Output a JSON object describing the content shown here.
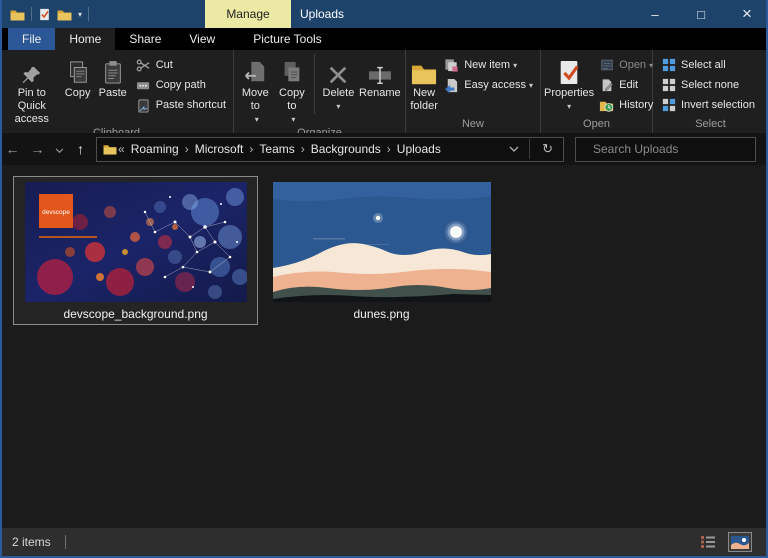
{
  "colors": {
    "titlebar": "#1d436b",
    "window_border": "#2a5a9b",
    "manage_tab_bg": "#ece9a4",
    "file_tab_bg": "#2b5797",
    "ribbon_bg": "#1f1f1f",
    "content_bg": "#1b1b1b",
    "statusbar_bg": "#2e2e2e",
    "select_icon_blue": "#4f9bdc",
    "folder_yellow": "#e9c35c",
    "properties_check_red": "#d14a21"
  },
  "icons": {
    "caret": "▾",
    "back": "←",
    "forward": "→",
    "up": "↑",
    "refresh": "↻",
    "chevrons_left": "«",
    "crumb_sep": "›",
    "minimize": "–",
    "maximize": "□",
    "close": "×"
  },
  "titlebar": {
    "contextual_tab": "Manage",
    "title": "Uploads"
  },
  "tabs": {
    "file": "File",
    "home": "Home",
    "share": "Share",
    "view": "View",
    "picture_tools": "Picture Tools"
  },
  "ribbon": {
    "clipboard": {
      "label": "Clipboard",
      "pin": "Pin to Quick access",
      "copy": "Copy",
      "paste": "Paste",
      "cut": "Cut",
      "copy_path": "Copy path",
      "paste_shortcut": "Paste shortcut"
    },
    "organize": {
      "label": "Organize",
      "move_to": "Move to",
      "copy_to": "Copy to",
      "del": "Delete",
      "rename": "Rename"
    },
    "new_group": {
      "label": "New",
      "new_folder": "New folder",
      "new_item": "New item",
      "easy_access": "Easy access"
    },
    "open_group": {
      "label": "Open",
      "properties": "Properties",
      "open": "Open",
      "edit": "Edit",
      "history": "History"
    },
    "select_group": {
      "label": "Select",
      "select_all": "Select all",
      "select_none": "Select none",
      "invert_selection": "Invert selection"
    }
  },
  "address": {
    "crumbs": [
      "Roaming",
      "Microsoft",
      "Teams",
      "Backgrounds",
      "Uploads"
    ]
  },
  "search": {
    "placeholder": "Search Uploads"
  },
  "files": [
    {
      "name": "devscope_background.png",
      "selected": true
    },
    {
      "name": "dunes.png",
      "selected": false
    }
  ],
  "logo_text": "devscope",
  "status": {
    "items_text": "2 items"
  }
}
